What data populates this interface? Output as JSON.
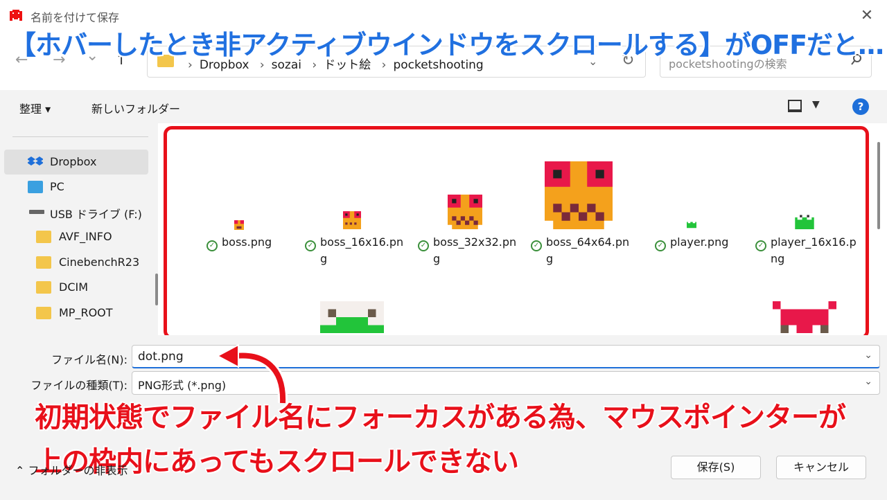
{
  "window": {
    "title": "名前を付けて保存",
    "close_label": "✕"
  },
  "banner": "【ホバーしたとき非アクティブウインドウをスクロールする】がOFFだと…",
  "nav": {
    "back": "←",
    "forward": "→",
    "recent": "⌄",
    "up": "↑"
  },
  "address": {
    "crumbs": [
      "Dropbox",
      "sozai",
      "ドット絵",
      "pocketshooting"
    ],
    "sep": "›",
    "dropdown": "⌄",
    "refresh": "↻"
  },
  "search": {
    "placeholder": "pocketshootingの検索",
    "icon": "search-icon"
  },
  "toolbar": {
    "organize": "整理 ▾",
    "new_folder": "新しいフォルダー",
    "help": "?"
  },
  "sidebar": {
    "items": [
      {
        "label": "Dropbox",
        "icon": "dropbox-icon"
      },
      {
        "label": "PC",
        "icon": "pc-icon"
      },
      {
        "label": "USB ドライブ (F:)",
        "icon": "usb-drive-icon"
      },
      {
        "label": "AVF_INFO",
        "icon": "folder-icon"
      },
      {
        "label": "CinebenchR23",
        "icon": "folder-icon"
      },
      {
        "label": "DCIM",
        "icon": "folder-icon"
      },
      {
        "label": "MP_ROOT",
        "icon": "folder-icon"
      }
    ]
  },
  "files": [
    {
      "name": "boss.png",
      "line2": ""
    },
    {
      "name": "boss_16x16.pn",
      "line2": "g"
    },
    {
      "name": "boss_32x32.pn",
      "line2": "g"
    },
    {
      "name": "boss_64x64.pn",
      "line2": "g"
    },
    {
      "name": "player.png",
      "line2": ""
    },
    {
      "name": "player_16x16.p",
      "line2": "ng"
    }
  ],
  "filename": {
    "label": "ファイル名(N):",
    "value": "dot.png"
  },
  "filetype": {
    "label": "ファイルの種類(T):",
    "value": "PNG形式 (*.png)"
  },
  "annotation": {
    "line1": "初期状態でファイル名にフォーカスがある為、マウスポインターが",
    "line2": "上の枠内にあってもスクロールできない"
  },
  "footer": {
    "hide_folders": "フォルダーの非表示",
    "save": "保存(S)",
    "cancel": "キャンセル"
  },
  "colors": {
    "accent": "#1e6fd9",
    "annotation_red": "#e8101a",
    "banner_blue": "#2070e0",
    "check_green": "#3a8f3a"
  }
}
